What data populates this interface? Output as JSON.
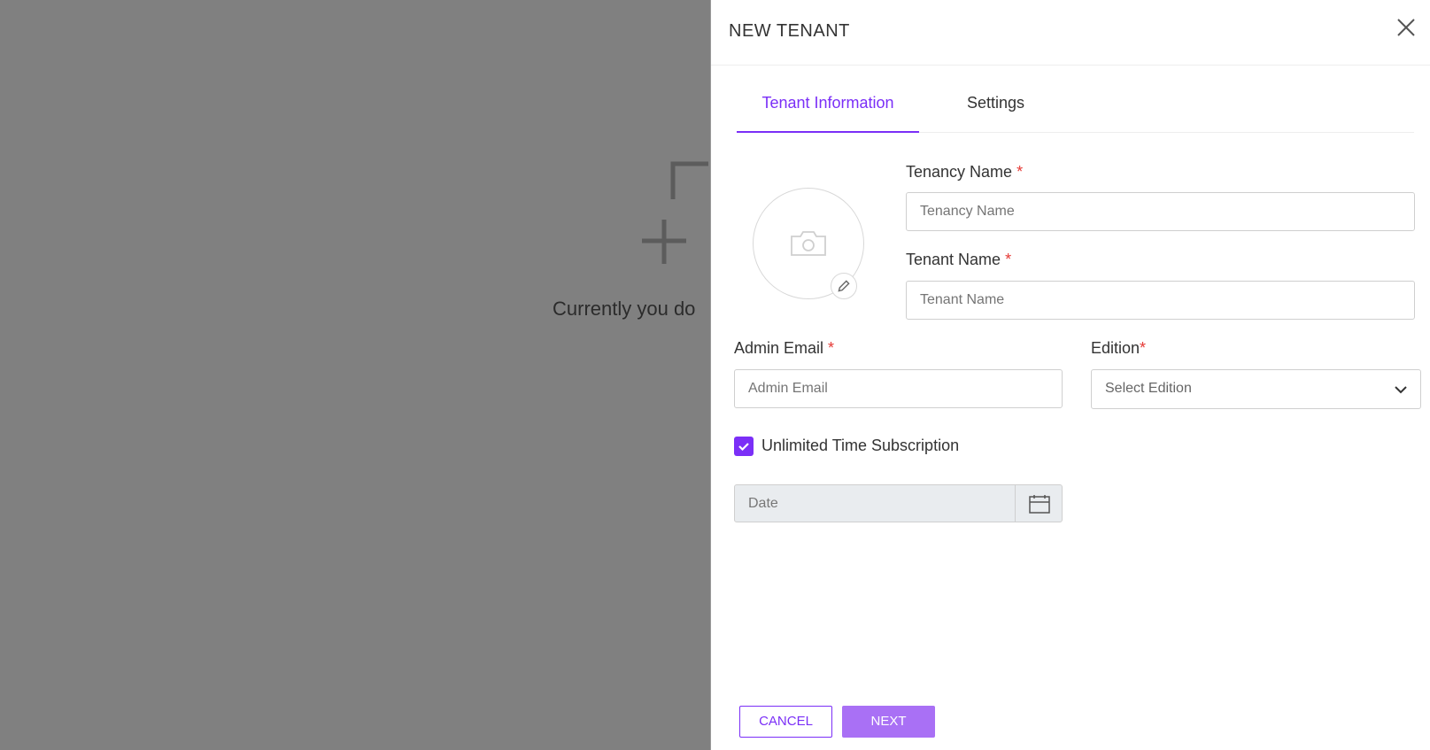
{
  "background": {
    "empty_text": "Currently you do"
  },
  "drawer": {
    "title": "NEW TENANT",
    "close_icon": "close-icon"
  },
  "tabs": [
    {
      "label": "Tenant Information",
      "active": true
    },
    {
      "label": "Settings",
      "active": false
    }
  ],
  "avatar": {
    "icon": "camera-icon",
    "edit_icon": "pencil-icon"
  },
  "form": {
    "tenancy_name": {
      "label": "Tenancy Name",
      "required_mark": "*",
      "placeholder": "Tenancy Name",
      "value": ""
    },
    "tenant_name": {
      "label": "Tenant Name",
      "required_mark": "*",
      "placeholder": "Tenant Name",
      "value": ""
    },
    "admin_email": {
      "label": "Admin Email",
      "required_mark": "*",
      "placeholder": "Admin Email",
      "value": ""
    },
    "edition": {
      "label": "Edition",
      "required_mark": "*",
      "selected": "Select Edition"
    },
    "unlimited": {
      "label": "Unlimited Time Subscription",
      "checked": true
    },
    "date": {
      "placeholder": "Date"
    }
  },
  "footer": {
    "cancel_label": "CANCEL",
    "next_label": "NEXT"
  },
  "colors": {
    "accent": "#7b2ff7",
    "accent_light": "#a970f5",
    "required": "#e53935",
    "overlay": "#808080"
  }
}
